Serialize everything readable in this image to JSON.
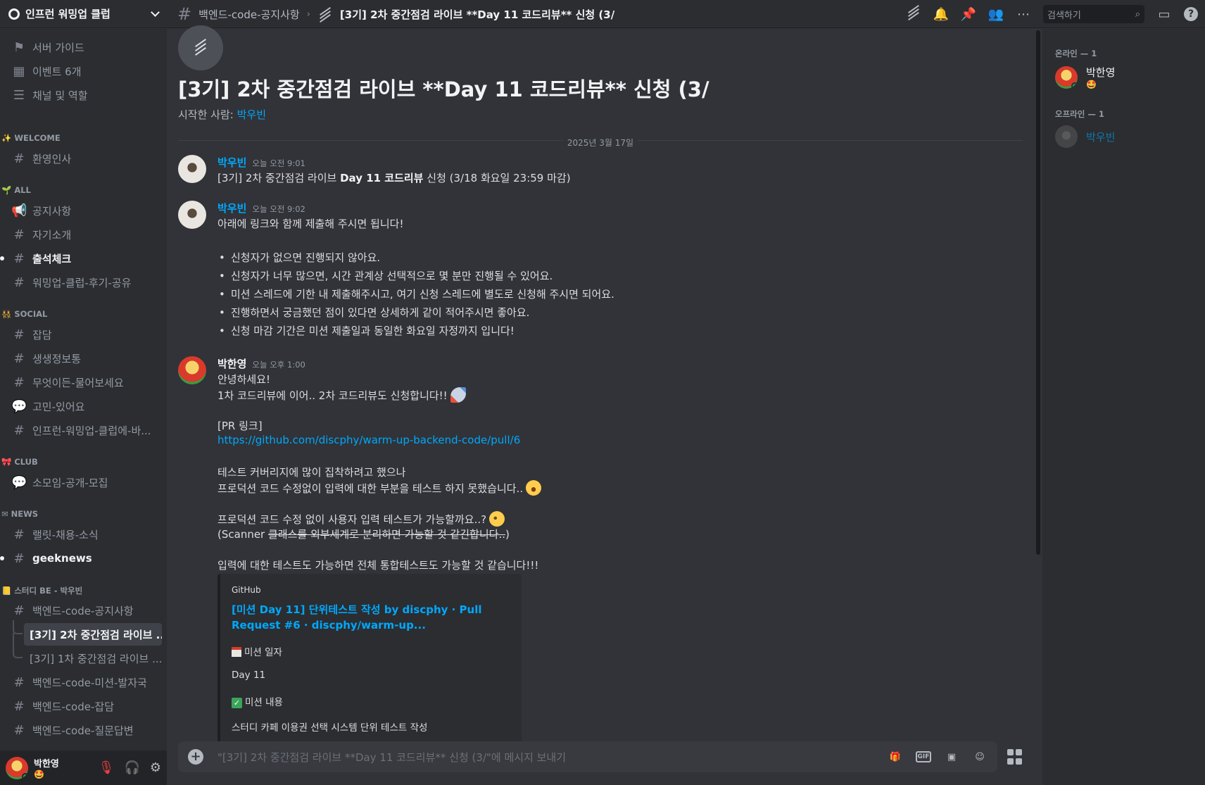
{
  "server": {
    "name": "인프런 워밍업 클럽"
  },
  "breadcrumb": {
    "parent": "백엔드-code-공지사항",
    "thread": "[3기] 2차 중간점검 라이브 **Day 11 코드리뷰** 신청 (3/"
  },
  "search": {
    "placeholder": "검색하기"
  },
  "sidebar": {
    "top_items": [
      {
        "label": "서버 가이드",
        "icon": "signpost-icon"
      },
      {
        "label": "이벤트 6개",
        "icon": "calendar-icon"
      },
      {
        "label": "채널 및 역할",
        "icon": "channels-roles-icon"
      }
    ],
    "categories": {
      "welcome": "✨ WELCOME",
      "all": "🌱 ALL",
      "social": "👯 SOCIAL",
      "club": "🎀 CLUB",
      "news": "✉ NEWS",
      "study": "📒 스터디 BE - 박우빈"
    },
    "channels": {
      "welcome": "환영인사",
      "notice": "공지사항",
      "intro": "자기소개",
      "attendance": "출석체크",
      "review_share": "워밍업-클럽-후기-공유",
      "chat": "잡담",
      "life": "생생정보통",
      "ask": "무엇이든-물어보세요",
      "worry": "고민-있어요",
      "inflearn": "인프런-워밍업-클럽에-바...",
      "club_recruit": "소모임-공개-모집",
      "rallit": "랠릿-채용-소식",
      "geeknews": "geeknews",
      "be_notice": "백엔드-code-공지사항",
      "thread_active": "[3기] 2차 중간점검 라이브 ...",
      "thread_other": "[3기] 1차 중간점검 라이브 ...",
      "be_mission": "백엔드-code-미션-발자국",
      "be_chat": "백엔드-code-잡담",
      "be_qna": "백엔드-code-질문답변"
    }
  },
  "user_panel": {
    "name": "박한영",
    "status_emoji": "🤩"
  },
  "thread": {
    "title": "[3기] 2차 중간점검 라이브 **Day 11 코드리뷰** 신청 (3/",
    "starter_label": "시작한 사람: ",
    "starter_name": "박우빈",
    "date": "2025년 3월 17일"
  },
  "messages": [
    {
      "author": "박우빈",
      "author_color": "#00a8fc",
      "time": "오늘 오전 9:01",
      "text_before": "[3기] 2차 중간점검 라이브 ",
      "text_bold": "Day 11 코드리뷰",
      "text_after": " 신청 (3/18 화요일 23:59 마감)"
    },
    {
      "author": "박우빈",
      "author_color": "#00a8fc",
      "time": "오늘 오전 9:02",
      "intro": "아래에 링크와 함께 제출해 주시면 됩니다!",
      "bullets": [
        "신청자가 없으면 진행되지 않아요.",
        "신청자가 너무 많으면, 시간 관계상 선택적으로 몇 분만 진행될 수 있어요.",
        "미션 스레드에 기한 내 제출해주시고, 여기 신청 스레드에 별도로 신청해 주시면 되어요.",
        "진행하면서 궁금했던 점이 있다면 상세하게 같이 적어주시면 좋아요.",
        "신청 마감 기간은 미션 제출일과 동일한 화요일 자정까지 입니다!"
      ]
    },
    {
      "author": "박한영",
      "author_color": "#f2f3f5",
      "time": "오늘 오후 1:00",
      "l1": "안녕하세요!",
      "l2": "1차 코드리뷰에 이어.. 2차 코드리뷰도 신청합니다!!",
      "l3": "[PR 링크]",
      "l4": "https://github.com/discphy/warm-up-backend-code/pull/6",
      "l5": "테스트 커버리지에 많이 집착하려고 했으나",
      "l6": "프로덕션 코드 수정없이 입력에 대한 부분을 테스트 하지 못했습니다..",
      "l7": "프로덕션 코드 수정 없이 사용자 입력 테스트가 가능할까요..?",
      "l8_plain": "(Scanner ",
      "l8_strike": "클래스를 외부세계로 분리하면 가능할 것 같긴합니다..",
      "l8_end": ")",
      "l9": "입력에 대한 테스트도 가능하면 전체 통합테스트도 가능할 것 같습니다!!!",
      "embed": {
        "provider": "GitHub",
        "title": "[미션 Day 11] 단위테스트 작성 by discphy · Pull Request #6 · discphy/warm-up...",
        "f1": "미션 일자",
        "f2": "Day 11",
        "f3": "미션 내용",
        "f4": "스터디 카페 이용권 선택 시스템 단위 테스트 작성"
      }
    }
  ],
  "composer": {
    "placeholder": "\"[3기] 2차 중간점검 라이브 **Day 11 코드리뷰** 신청 (3/\"에 메시지 보내기",
    "gif": "GIF"
  },
  "members": {
    "online_header": "온라인 — 1",
    "offline_header": "오프라인 — 1",
    "online": [
      {
        "name": "박한영",
        "status_emoji": "🤩"
      }
    ],
    "offline": [
      {
        "name": "박우빈"
      }
    ]
  },
  "colors": {
    "link": "#00a8fc",
    "background": "#313338",
    "sidebar": "#2b2d31",
    "online": "#23a55a"
  }
}
